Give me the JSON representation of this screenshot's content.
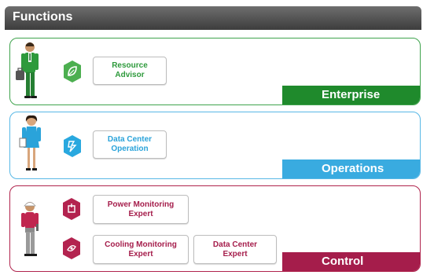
{
  "header": {
    "title": "Functions"
  },
  "colors": {
    "enterprise": "#1f8a2c",
    "operations": "#39abe0",
    "control": "#a51d4b",
    "header": "#4a4a4a"
  },
  "panels": {
    "enterprise": {
      "label": "Enterprise",
      "person_icon": "businessman-icon",
      "items": [
        {
          "label": "Resource Advisor",
          "icon": "leaf-icon"
        }
      ]
    },
    "operations": {
      "label": "Operations",
      "person_icon": "businesswoman-icon",
      "items": [
        {
          "label": "Data Center Operation",
          "icon": "operation-icon"
        }
      ]
    },
    "control": {
      "label": "Control",
      "person_icon": "technician-icon",
      "items": [
        {
          "label": "Power Monitoring Expert",
          "icon": "power-icon"
        },
        {
          "label": "Cooling Monitoring Expert",
          "icon": "cooling-icon"
        },
        {
          "label": "Data Center Expert",
          "icon": ""
        }
      ]
    }
  }
}
